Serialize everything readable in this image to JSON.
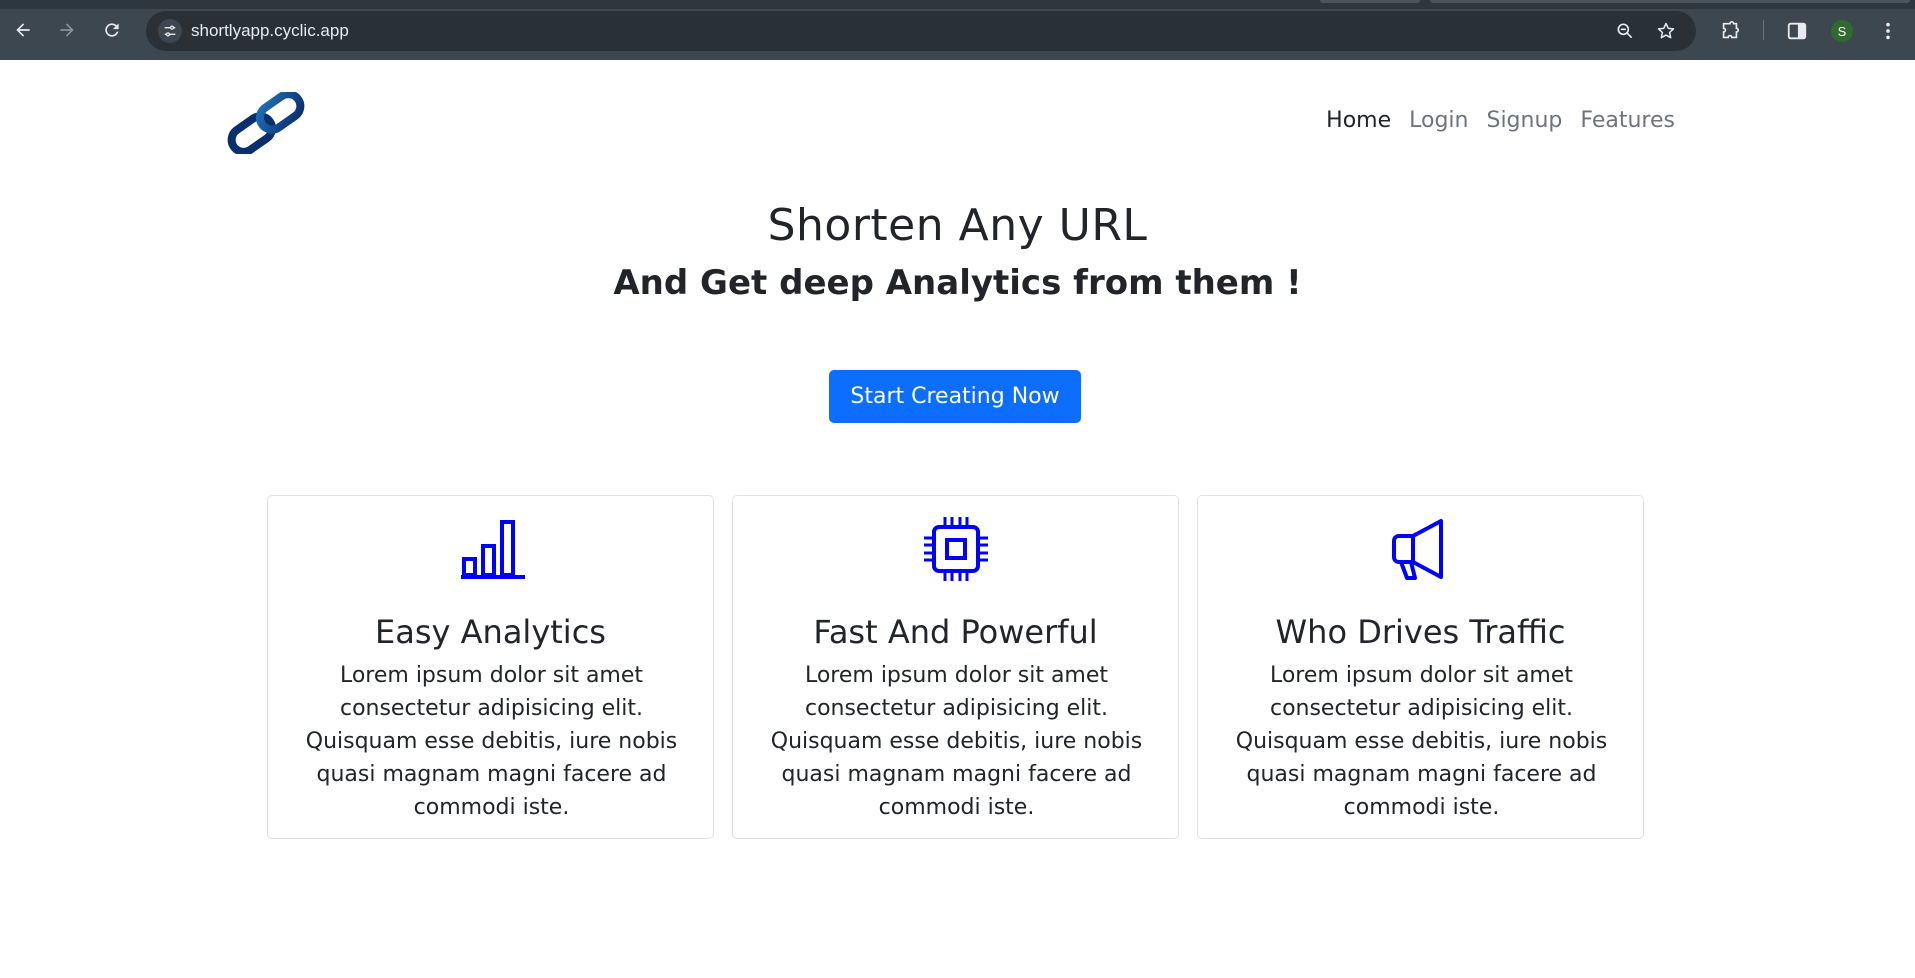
{
  "browser": {
    "url": "shortlyapp.cyclic.app",
    "profile_initial": "S",
    "icons": {
      "back": "arrow-left-icon",
      "forward": "arrow-right-icon",
      "reload": "reload-icon",
      "site_info": "tune-icon",
      "zoom": "zoom-out-icon",
      "bookmark": "star-icon",
      "extensions": "puzzle-icon",
      "side_panel": "side-panel-icon",
      "menu": "kebab-menu-icon"
    }
  },
  "nav": {
    "logo": "chain-link-logo",
    "links": [
      {
        "label": "Home",
        "active": true
      },
      {
        "label": "Login",
        "active": false
      },
      {
        "label": "Signup",
        "active": false
      },
      {
        "label": "Features",
        "active": false
      }
    ]
  },
  "hero": {
    "title": "Shorten Any URL",
    "subtitle": "And Get deep Analytics from them !",
    "cta_label": "Start Creating Now"
  },
  "features": [
    {
      "icon": "bar-chart-icon",
      "title": "Easy Analytics",
      "text": "Lorem ipsum dolor sit amet consectetur adipisicing elit. Quisquam esse debitis, iure nobis quasi magnam magni facere ad commodi iste."
    },
    {
      "icon": "cpu-chip-icon",
      "title": "Fast And Powerful",
      "text": "Lorem ipsum dolor sit amet consectetur adipisicing elit. Quisquam esse debitis, iure nobis quasi magnam magni facere ad commodi iste."
    },
    {
      "icon": "megaphone-icon",
      "title": "Who Drives Traffic",
      "text": "Lorem ipsum dolor sit amet consectetur adipisicing elit. Quisquam esse debitis, iure nobis quasi magnam magni facere ad commodi iste."
    }
  ],
  "colors": {
    "primary": "#0d6efd",
    "icon_blue": "#0000ff",
    "chrome_bg": "#3c474f",
    "omnibox_bg": "#2a3136",
    "nav_muted": "#6c757d",
    "text_dark": "#212529"
  }
}
